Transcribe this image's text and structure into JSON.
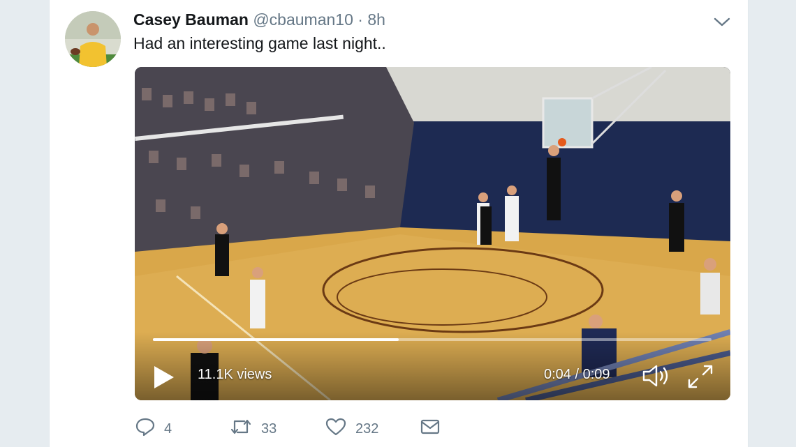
{
  "tweet": {
    "author_name": "Casey Bauman",
    "handle": "@cbauman10",
    "separator": "·",
    "time": "8h",
    "text": "Had an interesting game last night.."
  },
  "video": {
    "views": "11.1K views",
    "timecode": "0:04 / 0:09",
    "progress_fraction": 0.44
  },
  "actions": {
    "replies": "4",
    "retweets": "33",
    "likes": "232"
  },
  "icons": {
    "menu": "chevron-down-icon",
    "play": "play-icon",
    "volume": "volume-icon",
    "fullscreen": "fullscreen-icon",
    "reply": "reply-icon",
    "retweet": "retweet-icon",
    "like": "heart-icon",
    "message": "envelope-icon"
  },
  "colors": {
    "text_primary": "#14171a",
    "text_secondary": "#657786",
    "background": "#e6ecf0"
  }
}
